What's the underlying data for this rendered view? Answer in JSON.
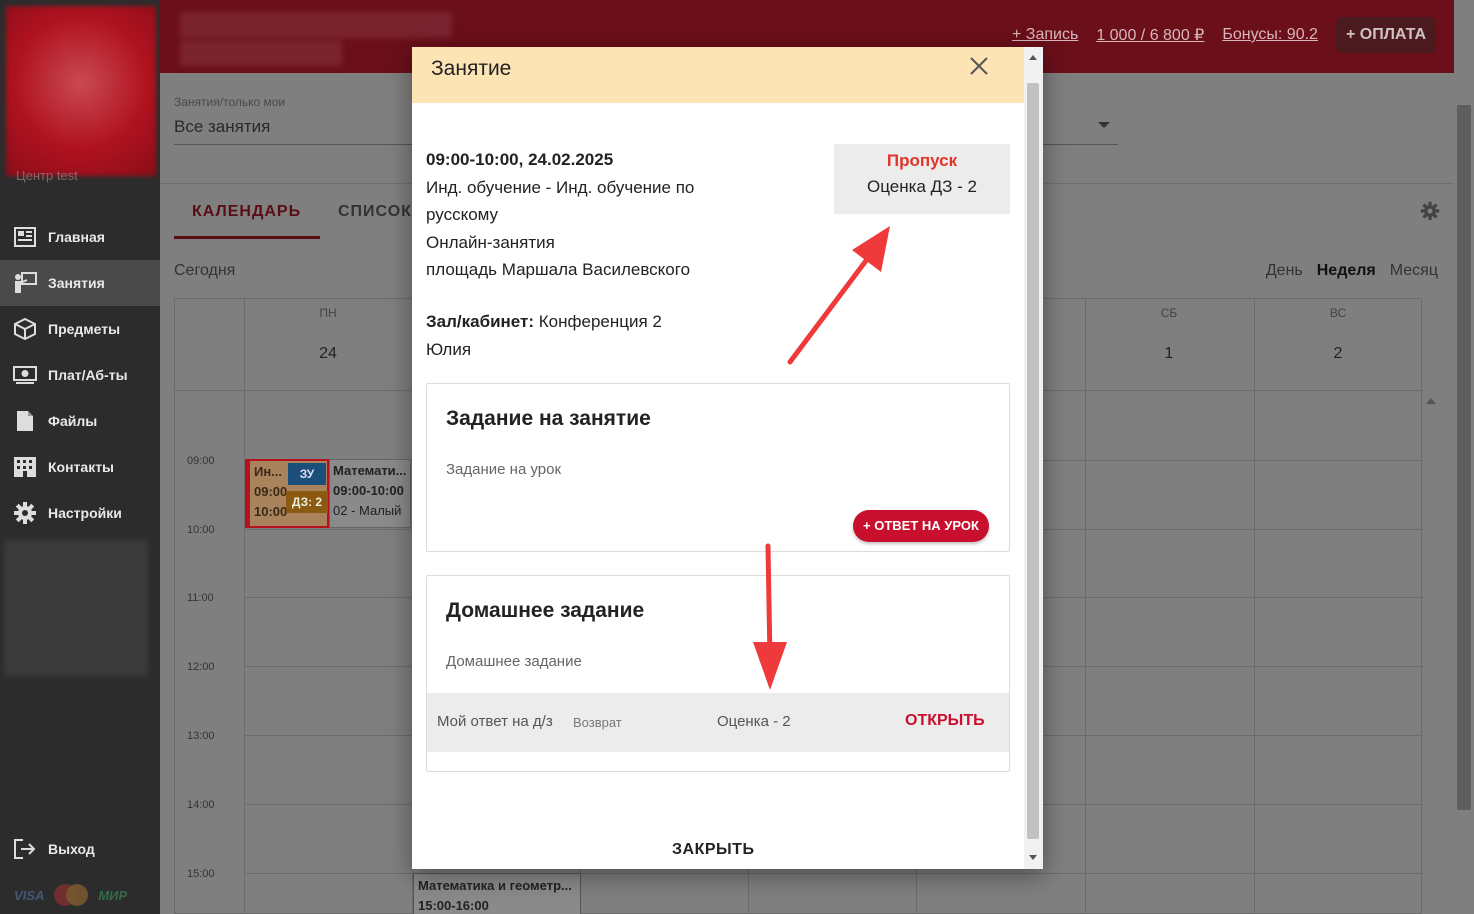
{
  "sidebar": {
    "org_label": "Центр test",
    "items": [
      {
        "label": "Главная",
        "icon": "dashboard-icon"
      },
      {
        "label": "Занятия",
        "icon": "teacher-board-icon",
        "active": true
      },
      {
        "label": "Предметы",
        "icon": "cube-icon"
      },
      {
        "label": "Плат/Аб-ты",
        "icon": "money-icon"
      },
      {
        "label": "Файлы",
        "icon": "file-icon"
      },
      {
        "label": "Контакты",
        "icon": "building-icon"
      },
      {
        "label": "Настройки",
        "icon": "gear-icon"
      }
    ],
    "logout": "Выход",
    "payment_logos": [
      "VISA",
      "MasterCard",
      "МИР"
    ]
  },
  "header": {
    "links": [
      "+ Запись",
      "1 000 / 6 800 ₽",
      "Бонусы: 90.2"
    ],
    "pay_button": "+ ОПЛАТА"
  },
  "main": {
    "filter_label": "Занятия/только мои",
    "filter_value": "Все занятия",
    "tabs": [
      "КАЛЕНДАРЬ",
      "СПИСОК"
    ],
    "today": "Сегодня",
    "views": [
      "День",
      "Неделя",
      "Месяц"
    ],
    "calendar": {
      "days": [
        {
          "name": "ПН",
          "num": "24"
        },
        {
          "name": "СБ",
          "num": "1"
        },
        {
          "name": "ВС",
          "num": "2"
        }
      ],
      "times": [
        "09:00",
        "10:00",
        "11:00",
        "12:00",
        "13:00",
        "14:00",
        "15:00"
      ],
      "events": {
        "ev1": {
          "l1": "Ин...",
          "l2": "09:00",
          "l3": "10:00",
          "badge1": "ЗУ",
          "badge2": "ДЗ: 2"
        },
        "ev2": {
          "l1": "Математи...",
          "l2": "09:00-10:00",
          "l3": "02 - Малый"
        },
        "ev3": {
          "l1": "Математика и геометр...",
          "l2": "15:00-16:00"
        }
      }
    }
  },
  "modal": {
    "title": "Занятие",
    "datetime": "09:00-10:00, 24.02.2025",
    "lines": [
      "Инд. обучение - Инд. обучение по русскому",
      "Онлайн-занятия",
      "площадь Маршала Василевского"
    ],
    "hall_label": "Зал/кабинет:",
    "hall_value": "Конференция 2",
    "teacher": "Юлия",
    "status": {
      "miss": "Пропуск",
      "grade": "Оценка ДЗ - 2"
    },
    "task": {
      "title": "Задание на занятие",
      "text": "Задание на урок",
      "button": "+ ОТВЕТ НА УРОК"
    },
    "homework": {
      "title": "Домашнее задание",
      "text": "Домашнее задание",
      "answer_label": "Мой ответ на д/з",
      "answer_status": "Возврат",
      "answer_grade": "Оценка - 2",
      "open": "ОТКРЫТЬ"
    },
    "close": "ЗАКРЫТЬ"
  },
  "colors": {
    "brand": "#c8102e",
    "header_bg": "#fde4b5",
    "miss": "#e0352b"
  }
}
